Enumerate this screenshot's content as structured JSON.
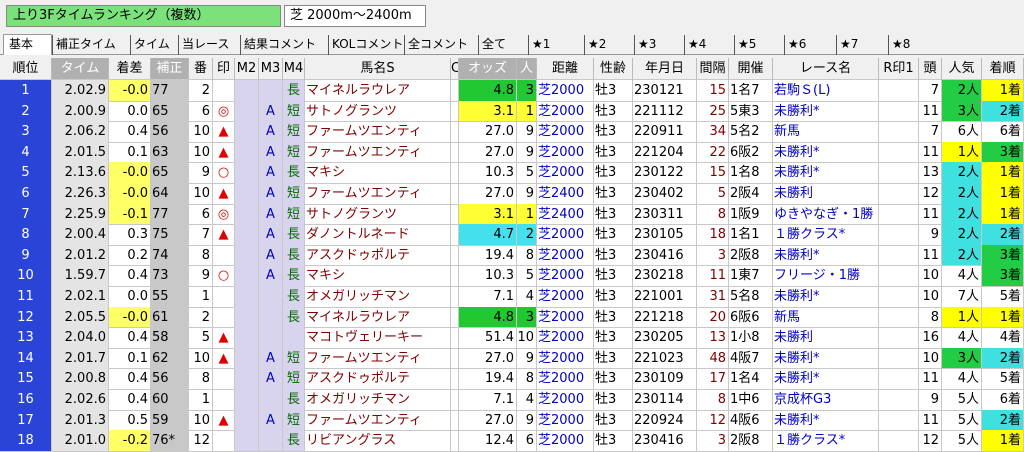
{
  "header": {
    "title": "上り3Fタイムランキング（複数）",
    "condition": "芝 2000m〜2400m"
  },
  "tabs": [
    "基本",
    "補正タイム",
    "タイム",
    "当レース",
    "結果コメント",
    "KOLコメント",
    "全コメント",
    "全て",
    "★1",
    "★2",
    "★3",
    "★4",
    "★5",
    "★6",
    "★7",
    "★8"
  ],
  "columns": {
    "rank": "順位",
    "time": "タイム",
    "margin": "着差",
    "hosei": "補正",
    "ban": "番",
    "mark": "印",
    "m2": "M2",
    "m3": "M3",
    "m4": "M4",
    "name": "馬名S",
    "c": "C",
    "odds": "オッズ",
    "ninki": "人",
    "dist": "距離",
    "sex": "性齢",
    "date": "年月日",
    "interval": "間隔",
    "venue": "開催",
    "race": "レース名",
    "rmark": "R印1",
    "heads": "頭",
    "pop": "人気",
    "finish": "着順"
  },
  "colors": {
    "rank_bg": "#2a44d8",
    "odds_green": "#22c832",
    "odds_yellow": "#ffff33",
    "odds_cyan": "#44e0ee",
    "finish_yellow": "#ffff00",
    "finish_green": "#22cc44",
    "pop_green": "#22cc44",
    "pop_cyan": "#3fe0e0",
    "margin_yellow": "#ffff66"
  },
  "rows": [
    {
      "rank": "1",
      "time": "2.02.9",
      "margin": "-0.0",
      "margin_hl": true,
      "hosei": "77",
      "ban": "2",
      "mark": "",
      "m4": "長",
      "name": "マイネルラウレア",
      "odds": "4.8",
      "ninki": "3",
      "odds_hl": "green",
      "dist": "芝2000",
      "sex": "牡3",
      "date": "230121",
      "interval": "15",
      "venue": "1名7",
      "race": "若駒Ｓ(L)",
      "heads": "7",
      "pop": "2人",
      "pop_hl": "green",
      "finish": "1着",
      "finish_hl": "yellow"
    },
    {
      "rank": "2",
      "time": "2.00.9",
      "margin": "0.0",
      "margin_hl": false,
      "hosei": "65",
      "ban": "6",
      "mark": "◎",
      "m3": "A",
      "m4": "短",
      "name": "サトノグランツ",
      "odds": "3.1",
      "ninki": "1",
      "odds_hl": "yellow",
      "dist": "芝2000",
      "sex": "牡3",
      "date": "221112",
      "interval": "25",
      "venue": "5東3",
      "race": "未勝利*",
      "heads": "11",
      "pop": "3人",
      "pop_hl": "green",
      "finish": "2着",
      "finish_hl": "cyan"
    },
    {
      "rank": "3",
      "time": "2.06.2",
      "margin": "0.4",
      "margin_hl": false,
      "hosei": "56",
      "ban": "10",
      "mark": "▲",
      "m3": "A",
      "m4": "短",
      "name": "ファームツエンティ",
      "odds": "27.0",
      "ninki": "9",
      "odds_hl": "",
      "dist": "芝2000",
      "sex": "牡3",
      "date": "220911",
      "interval": "34",
      "venue": "5名2",
      "race": "新馬",
      "heads": "7",
      "pop": "6人",
      "pop_hl": "",
      "finish": "6着",
      "finish_hl": ""
    },
    {
      "rank": "4",
      "time": "2.01.5",
      "margin": "0.1",
      "margin_hl": false,
      "hosei": "63",
      "ban": "10",
      "mark": "▲",
      "m3": "A",
      "m4": "短",
      "name": "ファームツエンティ",
      "odds": "27.0",
      "ninki": "9",
      "odds_hl": "",
      "dist": "芝2000",
      "sex": "牡3",
      "date": "221204",
      "interval": "22",
      "venue": "6阪2",
      "race": "未勝利*",
      "heads": "11",
      "pop": "1人",
      "pop_hl": "yellow",
      "finish": "3着",
      "finish_hl": "green"
    },
    {
      "rank": "5",
      "time": "2.13.6",
      "margin": "-0.0",
      "margin_hl": true,
      "hosei": "65",
      "ban": "9",
      "mark": "○",
      "m3": "A",
      "m4": "長",
      "name": "マキシ",
      "odds": "10.3",
      "ninki": "5",
      "odds_hl": "",
      "dist": "芝2000",
      "sex": "牡3",
      "date": "230122",
      "interval": "15",
      "venue": "1名8",
      "race": "未勝利*",
      "heads": "13",
      "pop": "2人",
      "pop_hl": "cyan",
      "finish": "1着",
      "finish_hl": "yellow"
    },
    {
      "rank": "6",
      "time": "2.26.3",
      "margin": "-0.0",
      "margin_hl": true,
      "hosei": "64",
      "ban": "10",
      "mark": "▲",
      "m3": "A",
      "m4": "短",
      "name": "ファームツエンティ",
      "odds": "27.0",
      "ninki": "9",
      "odds_hl": "",
      "dist": "芝2400",
      "sex": "牡3",
      "date": "230402",
      "interval": "5",
      "venue": "2阪4",
      "race": "未勝利",
      "heads": "12",
      "pop": "2人",
      "pop_hl": "cyan",
      "finish": "1着",
      "finish_hl": "yellow"
    },
    {
      "rank": "7",
      "time": "2.25.9",
      "margin": "-0.1",
      "margin_hl": true,
      "hosei": "77",
      "ban": "6",
      "mark": "◎",
      "m3": "A",
      "m4": "短",
      "name": "サトノグランツ",
      "odds": "3.1",
      "ninki": "1",
      "odds_hl": "yellow",
      "dist": "芝2400",
      "sex": "牡3",
      "date": "230311",
      "interval": "8",
      "venue": "1阪9",
      "race": "ゆきやなぎ・1勝",
      "heads": "11",
      "pop": "2人",
      "pop_hl": "cyan",
      "finish": "1着",
      "finish_hl": "yellow"
    },
    {
      "rank": "8",
      "time": "2.00.4",
      "margin": "0.3",
      "margin_hl": false,
      "hosei": "75",
      "ban": "7",
      "mark": "▲",
      "m3": "A",
      "m4": "長",
      "name": "ダノントルネード",
      "odds": "4.7",
      "ninki": "2",
      "odds_hl": "cyan",
      "dist": "芝2000",
      "sex": "牡3",
      "date": "230105",
      "interval": "18",
      "venue": "1名1",
      "race": "１勝クラス*",
      "heads": "9",
      "pop": "2人",
      "pop_hl": "cyan",
      "finish": "2着",
      "finish_hl": "cyan"
    },
    {
      "rank": "9",
      "time": "2.01.2",
      "margin": "0.2",
      "margin_hl": false,
      "hosei": "74",
      "ban": "8",
      "mark": "",
      "m3": "A",
      "m4": "長",
      "name": "アスクドゥポルテ",
      "odds": "19.4",
      "ninki": "8",
      "odds_hl": "",
      "dist": "芝2000",
      "sex": "牡3",
      "date": "230416",
      "interval": "3",
      "venue": "2阪8",
      "race": "未勝利*",
      "heads": "11",
      "pop": "2人",
      "pop_hl": "cyan",
      "finish": "3着",
      "finish_hl": "green"
    },
    {
      "rank": "10",
      "time": "1.59.7",
      "margin": "0.4",
      "margin_hl": false,
      "hosei": "73",
      "ban": "9",
      "mark": "○",
      "m3": "A",
      "m4": "長",
      "name": "マキシ",
      "odds": "10.3",
      "ninki": "5",
      "odds_hl": "",
      "dist": "芝2000",
      "sex": "牡3",
      "date": "230218",
      "interval": "11",
      "venue": "1東7",
      "race": "フリージ・1勝",
      "heads": "10",
      "pop": "4人",
      "pop_hl": "",
      "finish": "3着",
      "finish_hl": "green"
    },
    {
      "rank": "11",
      "time": "2.02.1",
      "margin": "0.0",
      "margin_hl": false,
      "hosei": "55",
      "ban": "1",
      "mark": "",
      "m4": "長",
      "name": "オメガリッチマン",
      "odds": "7.1",
      "ninki": "4",
      "odds_hl": "",
      "dist": "芝2000",
      "sex": "牡3",
      "date": "221001",
      "interval": "31",
      "venue": "5名8",
      "race": "未勝利*",
      "heads": "10",
      "pop": "7人",
      "pop_hl": "",
      "finish": "5着",
      "finish_hl": ""
    },
    {
      "rank": "12",
      "time": "2.05.5",
      "margin": "-0.0",
      "margin_hl": true,
      "hosei": "61",
      "ban": "2",
      "mark": "",
      "m4": "長",
      "name": "マイネルラウレア",
      "odds": "4.8",
      "ninki": "3",
      "odds_hl": "green",
      "dist": "芝2000",
      "sex": "牡3",
      "date": "221218",
      "interval": "20",
      "venue": "6阪6",
      "race": "新馬",
      "heads": "8",
      "pop": "1人",
      "pop_hl": "yellow",
      "finish": "1着",
      "finish_hl": "yellow"
    },
    {
      "rank": "13",
      "time": "2.04.0",
      "margin": "0.4",
      "margin_hl": false,
      "hosei": "58",
      "ban": "5",
      "mark": "▲",
      "m4": "",
      "name": "マコトヴェリーキー",
      "odds": "51.4",
      "ninki": "10",
      "odds_hl": "",
      "dist": "芝2000",
      "sex": "牡3",
      "date": "230205",
      "interval": "13",
      "venue": "1小8",
      "race": "未勝利",
      "heads": "16",
      "pop": "4人",
      "pop_hl": "",
      "finish": "4着",
      "finish_hl": ""
    },
    {
      "rank": "14",
      "time": "2.01.7",
      "margin": "0.1",
      "margin_hl": false,
      "hosei": "62",
      "ban": "10",
      "mark": "▲",
      "m3": "A",
      "m4": "短",
      "name": "ファームツエンティ",
      "odds": "27.0",
      "ninki": "9",
      "odds_hl": "",
      "dist": "芝2000",
      "sex": "牡3",
      "date": "221023",
      "interval": "48",
      "venue": "4阪7",
      "race": "未勝利*",
      "heads": "10",
      "pop": "3人",
      "pop_hl": "green",
      "finish": "2着",
      "finish_hl": "cyan"
    },
    {
      "rank": "15",
      "time": "2.00.8",
      "margin": "0.4",
      "margin_hl": false,
      "hosei": "56",
      "ban": "8",
      "mark": "",
      "m3": "A",
      "m4": "短",
      "name": "アスクドゥポルテ",
      "odds": "19.4",
      "ninki": "8",
      "odds_hl": "",
      "dist": "芝2000",
      "sex": "牡3",
      "date": "230109",
      "interval": "17",
      "venue": "1名4",
      "race": "未勝利*",
      "heads": "11",
      "pop": "4人",
      "pop_hl": "",
      "finish": "5着",
      "finish_hl": ""
    },
    {
      "rank": "16",
      "time": "2.02.6",
      "margin": "0.4",
      "margin_hl": false,
      "hosei": "60",
      "ban": "1",
      "mark": "",
      "m4": "長",
      "name": "オメガリッチマン",
      "odds": "7.1",
      "ninki": "4",
      "odds_hl": "",
      "dist": "芝2000",
      "sex": "牡3",
      "date": "230114",
      "interval": "8",
      "venue": "1中6",
      "race": "京成杯G3",
      "heads": "9",
      "pop": "5人",
      "pop_hl": "",
      "finish": "6着",
      "finish_hl": ""
    },
    {
      "rank": "17",
      "time": "2.01.3",
      "margin": "0.5",
      "margin_hl": false,
      "hosei": "59",
      "ban": "10",
      "mark": "▲",
      "m3": "A",
      "m4": "短",
      "name": "ファームツエンティ",
      "odds": "27.0",
      "ninki": "9",
      "odds_hl": "",
      "dist": "芝2000",
      "sex": "牡3",
      "date": "220924",
      "interval": "12",
      "venue": "4阪6",
      "race": "未勝利*",
      "heads": "11",
      "pop": "5人",
      "pop_hl": "",
      "finish": "2着",
      "finish_hl": "cyan"
    },
    {
      "rank": "18",
      "time": "2.01.0",
      "margin": "-0.2",
      "margin_hl": true,
      "hosei": "76*",
      "ban": "12",
      "mark": "",
      "m4": "長",
      "name": "リビアングラス",
      "odds": "12.4",
      "ninki": "6",
      "odds_hl": "",
      "dist": "芝2000",
      "sex": "牡3",
      "date": "230416",
      "interval": "3",
      "venue": "2阪8",
      "race": "１勝クラス*",
      "heads": "12",
      "pop": "5人",
      "pop_hl": "",
      "finish": "1着",
      "finish_hl": "yellow"
    }
  ]
}
